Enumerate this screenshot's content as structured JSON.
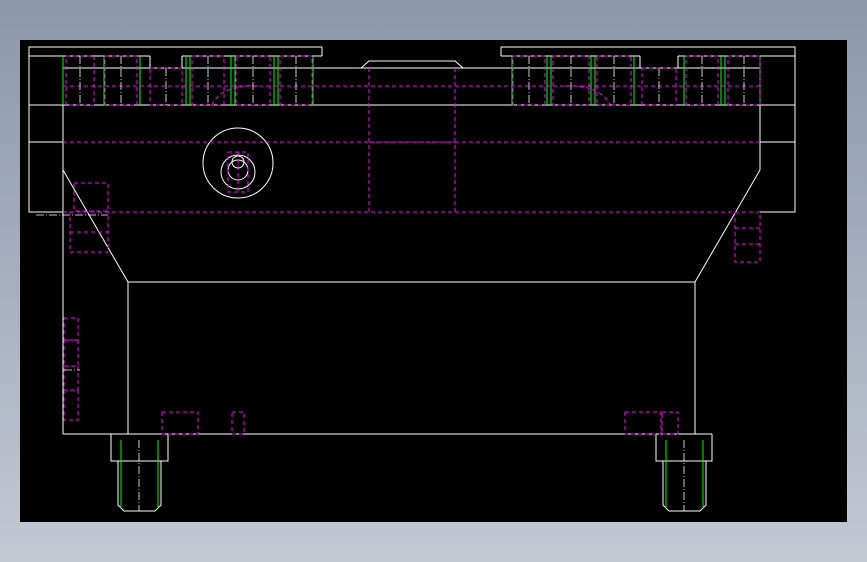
{
  "viewer": {
    "background": "#000000",
    "frame_gradient_top": "#8b98aa",
    "frame_gradient_bottom": "#c3c9d3"
  },
  "drawing": {
    "colors": {
      "outline": "#ffffff",
      "hidden": "#ff00ff",
      "thread": "#00ff00",
      "centerline": "#ffffff"
    }
  }
}
